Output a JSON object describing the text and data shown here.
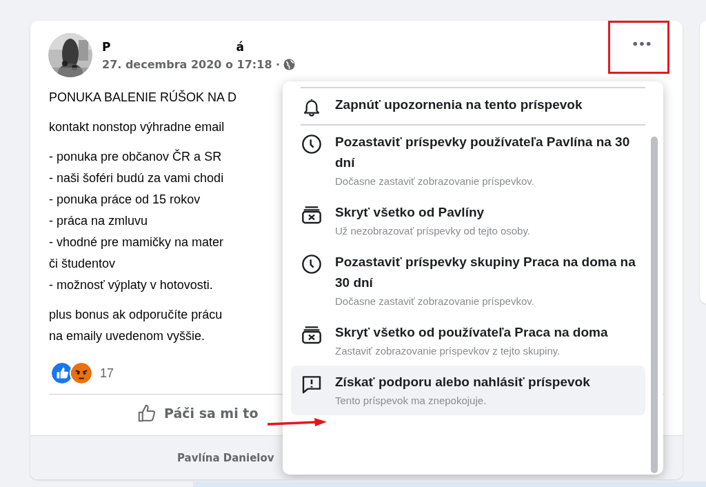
{
  "post": {
    "author_start": "P",
    "author_end": "á",
    "time": "27. decembra 2020 o 17:18 ·",
    "paragraphs": [
      [
        "PONUKA BALENIE RÚŠOK NA D"
      ],
      [
        "kontakt nonstop výhradne email"
      ],
      [
        "- ponuka pre občanov ČR a SR",
        "- naši šoféri budú za vami chodi",
        "- ponuka práce od 15 rokov",
        "- práca na zmluvu",
        "- vhodné pre mamičky na mater",
        "či študentov",
        "- možnosť výplaty v hotovosti."
      ],
      [
        "plus bonus ak odporučíte prácu",
        "na emaily uvedenom vyššie."
      ]
    ],
    "reaction_count": "17",
    "like_label": "Páči sa mi to",
    "commenter": "Pavlína Danielov"
  },
  "menu": {
    "items": [
      {
        "kind": "bell",
        "title": "Zapnúť upozornenia na tento príspevok",
        "selected": false
      },
      {
        "kind": "clock",
        "title": "Pozastaviť príspevky používateľa Pavlína na 30 dní",
        "subtitle": "Dočasne zastaviť zobrazovanie príspevkov.",
        "selected": false
      },
      {
        "kind": "hide",
        "title": "Skryť všetko od Pavlíny",
        "subtitle": "Už nezobrazovať príspevky od tejto osoby.",
        "selected": false
      },
      {
        "kind": "clock",
        "title": "Pozastaviť príspevky skupiny Praca na doma na 30 dní",
        "subtitle": "Dočasne zastaviť zobrazovanie príspevkov.",
        "selected": false
      },
      {
        "kind": "hide",
        "title": "Skryť všetko od používateľa Praca na doma",
        "subtitle": "Zastaviť zobrazovanie príspevkov z tejto skupiny.",
        "selected": false
      },
      {
        "kind": "report",
        "title": "Získať podporu alebo nahlásiť príspevok",
        "subtitle": "Tento príspevok ma znepokojuje.",
        "selected": true
      }
    ]
  }
}
